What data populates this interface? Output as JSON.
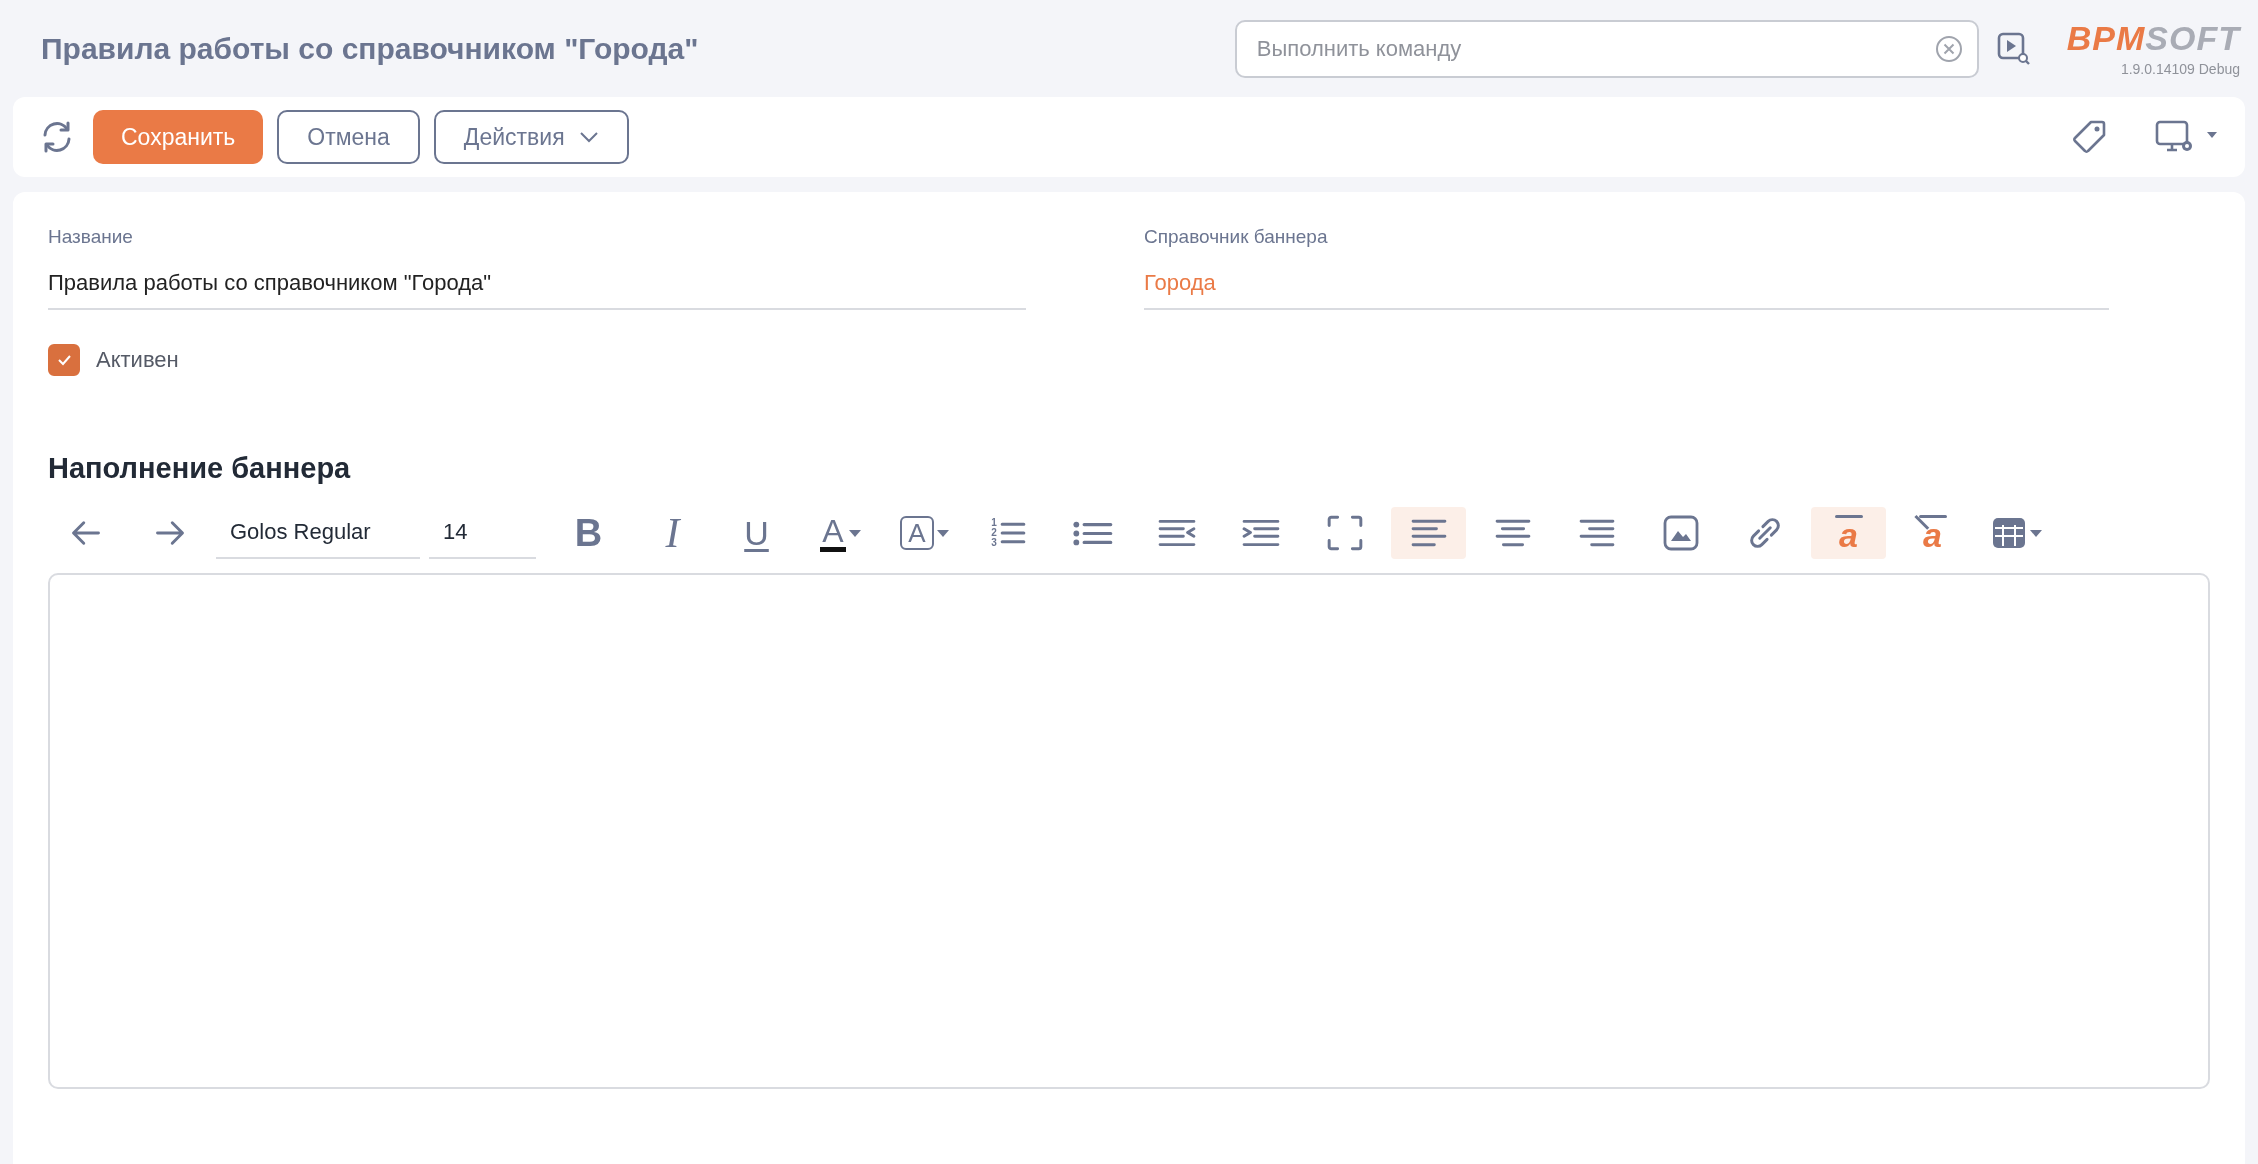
{
  "header": {
    "title": "Правила работы со справочником \"Города\"",
    "command_search": {
      "placeholder": "Выполнить команду"
    },
    "logo": {
      "brand_primary": "BPM",
      "brand_secondary": "SOFT",
      "version": "1.9.0.14109 Debug"
    }
  },
  "toolbar": {
    "buttons": [
      {
        "label": "Сохранить",
        "kind": "primary"
      },
      {
        "label": "Отмена",
        "kind": "outline"
      },
      {
        "label": "Действия",
        "kind": "dropdown"
      }
    ]
  },
  "form": {
    "fields": [
      {
        "label": "Название",
        "value": "Правила работы со справочником \"Города\"",
        "kind": "text"
      },
      {
        "label": "Справочник баннера",
        "value": "Города",
        "kind": "lookup"
      }
    ],
    "active": {
      "label": "Активен",
      "checked": true
    }
  },
  "content": {
    "title": "Наполнение баннера",
    "tools": [
      {
        "kind": "undo",
        "selected": false
      },
      {
        "kind": "redo",
        "selected": false
      },
      {
        "kind": "font",
        "value": "Golos Regular"
      },
      {
        "kind": "size",
        "value": "14"
      },
      {
        "kind": "bold",
        "glyph": "B",
        "selected": false
      },
      {
        "kind": "italic",
        "glyph": "I",
        "selected": false
      },
      {
        "kind": "underline",
        "glyph": "U",
        "selected": false
      },
      {
        "kind": "font-color",
        "glyph": "A",
        "selected": false
      },
      {
        "kind": "background-color",
        "glyph": "A",
        "selected": false
      },
      {
        "kind": "ordered-list",
        "glyph_numbers": [
          "1",
          "2",
          "3"
        ],
        "selected": false
      },
      {
        "kind": "bullet-list",
        "selected": false
      },
      {
        "kind": "outdent",
        "selected": false
      },
      {
        "kind": "indent",
        "selected": false
      },
      {
        "kind": "fullscreen",
        "selected": false
      },
      {
        "kind": "align-left",
        "selected": true
      },
      {
        "kind": "align-center",
        "selected": false
      },
      {
        "kind": "align-right",
        "selected": false
      },
      {
        "kind": "image",
        "selected": false
      },
      {
        "kind": "link",
        "selected": false
      },
      {
        "kind": "highlight",
        "glyph": "a",
        "selected": true
      },
      {
        "kind": "clear-highlight",
        "glyph": "a",
        "selected": false
      },
      {
        "kind": "table",
        "selected": false
      }
    ]
  }
}
